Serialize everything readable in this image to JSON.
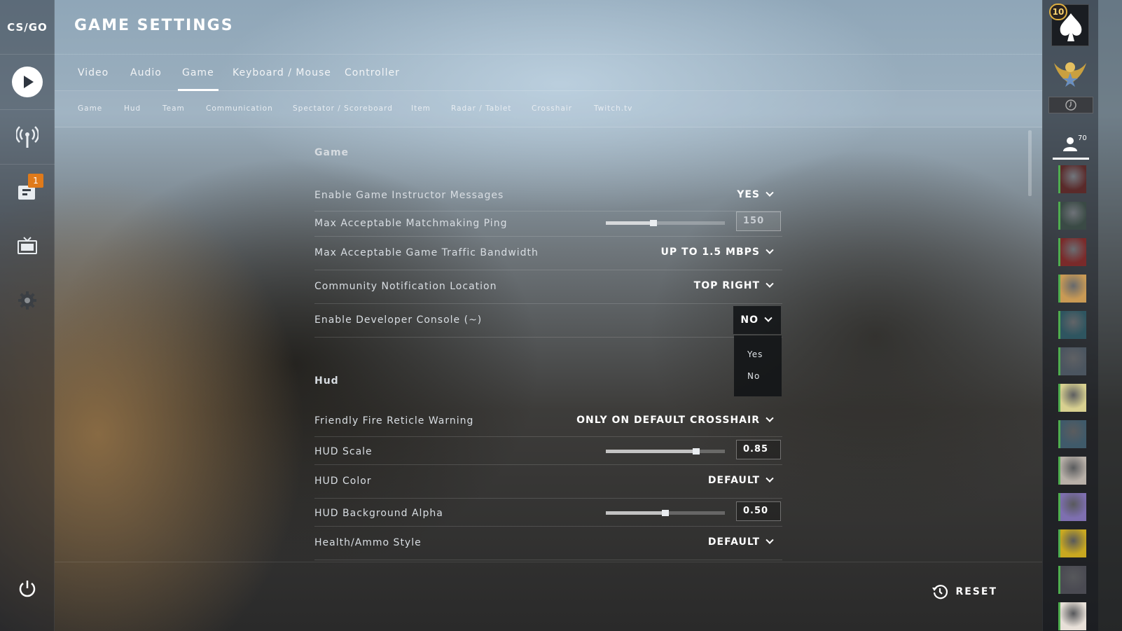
{
  "app": {
    "logo_text": "CS/GO"
  },
  "header": {
    "title": "GAME SETTINGS"
  },
  "left_nav": {
    "items": [
      {
        "name": "play",
        "icon": "play-icon"
      },
      {
        "name": "watch",
        "icon": "antenna-icon"
      },
      {
        "name": "inventory",
        "icon": "inventory-icon",
        "badge": "1"
      },
      {
        "name": "tv",
        "icon": "tv-icon"
      },
      {
        "name": "settings",
        "icon": "gear-icon"
      }
    ],
    "power_icon": "power-icon"
  },
  "main_tabs": [
    {
      "label": "Video"
    },
    {
      "label": "Audio"
    },
    {
      "label": "Game",
      "active": true
    },
    {
      "label": "Keyboard / Mouse"
    },
    {
      "label": "Controller"
    }
  ],
  "sub_tabs": [
    {
      "label": "Game"
    },
    {
      "label": "Hud"
    },
    {
      "label": "Team"
    },
    {
      "label": "Communication"
    },
    {
      "label": "Spectator / Scoreboard"
    },
    {
      "label": "Item"
    },
    {
      "label": "Radar / Tablet"
    },
    {
      "label": "Crosshair"
    },
    {
      "label": "Twitch.tv"
    }
  ],
  "sections": {
    "game": {
      "title": "Game",
      "rows": [
        {
          "label": "Enable Game Instructor Messages",
          "type": "dropdown",
          "value": "YES"
        },
        {
          "label": "Max Acceptable Matchmaking Ping",
          "type": "slider",
          "value": "150",
          "level": 0.4
        },
        {
          "label": "Max Acceptable Game Traffic Bandwidth",
          "type": "dropdown",
          "value": "UP TO 1.5 MBPS"
        },
        {
          "label": "Community Notification Location",
          "type": "dropdown",
          "value": "TOP RIGHT"
        },
        {
          "label": "Enable Developer Console (~)",
          "type": "dropdown",
          "value": "NO",
          "open": true
        }
      ]
    },
    "hud": {
      "title": "Hud",
      "rows": [
        {
          "label": "Friendly Fire Reticle Warning",
          "type": "dropdown",
          "value": "ONLY ON DEFAULT CROSSHAIR"
        },
        {
          "label": "HUD Scale",
          "type": "slider",
          "value": "0.85",
          "level": 0.76
        },
        {
          "label": "HUD Color",
          "type": "dropdown",
          "value": "DEFAULT"
        },
        {
          "label": "HUD Background Alpha",
          "type": "slider",
          "value": "0.50",
          "level": 0.5
        },
        {
          "label": "Health/Ammo Style",
          "type": "dropdown",
          "value": "DEFAULT"
        }
      ]
    }
  },
  "dropdown_menu": {
    "options": [
      "Yes",
      "No"
    ]
  },
  "bottom": {
    "reset_label": "RESET",
    "reset_icon": "history-icon"
  },
  "right_panel": {
    "rank_level": "10",
    "friends_count": "70",
    "friend_count_icon": "person-icon",
    "avatar_colors": [
      "#5a2a2a",
      "#3a4a45",
      "#7a2a2a",
      "#c99a55",
      "#2e5560",
      "#4b5560",
      "#d8d090",
      "#3f5a6a",
      "#b8b0a8",
      "#7e6fb0",
      "#c9a820",
      "#4a4a52",
      "#e8e0d8"
    ]
  },
  "colors": {
    "accent": "#ffffff",
    "badge": "#e07a1a",
    "online": "#4fae4f"
  }
}
